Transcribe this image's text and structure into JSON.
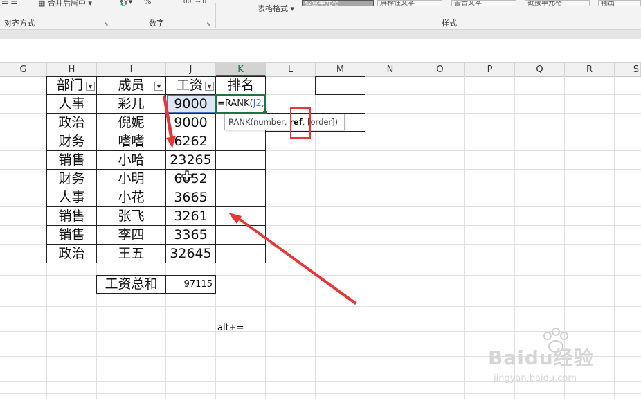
{
  "ribbon": {
    "merge_label": "合并后居中",
    "percent_symbol": "%",
    "decimal_increase": ".00",
    "decimal_decrease": "→.0",
    "table_format_label": "表格格式",
    "group_alignment": "对齐方式",
    "group_number": "数字",
    "group_styles": "样式",
    "style_cells": [
      "检查单元格",
      "解释性文本",
      "警告文本",
      "链接单元格",
      "输出"
    ]
  },
  "columns": [
    "G",
    "H",
    "I",
    "J",
    "K",
    "L",
    "M",
    "N",
    "O",
    "P",
    "Q",
    "R",
    "S"
  ],
  "table": {
    "headers": [
      "部门",
      "成员",
      "工资",
      "排名"
    ],
    "rows": [
      [
        "人事",
        "彩儿",
        "9000"
      ],
      [
        "政治",
        "倪妮",
        "9000"
      ],
      [
        "财务",
        "嗜嗜",
        "6262"
      ],
      [
        "销售",
        "小哈",
        "23265"
      ],
      [
        "财务",
        "小明",
        "6052"
      ],
      [
        "人事",
        "小花",
        "3665"
      ],
      [
        "销售",
        "张飞",
        "3261"
      ],
      [
        "销售",
        "李四",
        "3365"
      ],
      [
        "政治",
        "王五",
        "32645"
      ]
    ],
    "total_label": "工资总和",
    "total_value": "97115"
  },
  "editing": {
    "formula_prefix": "=RANK(",
    "formula_ref": "J2,"
  },
  "tooltip": {
    "func": "RANK(number, ",
    "bold_arg": "ref",
    "rest": ", [order])"
  },
  "note": "alt+=",
  "watermark": {
    "brand": "Baidu经验",
    "url": "jingyan.baidu.com"
  },
  "colors": {
    "excel_green": "#217346",
    "annotation_red": "#e33333",
    "ref_blue": "#4472c4"
  }
}
